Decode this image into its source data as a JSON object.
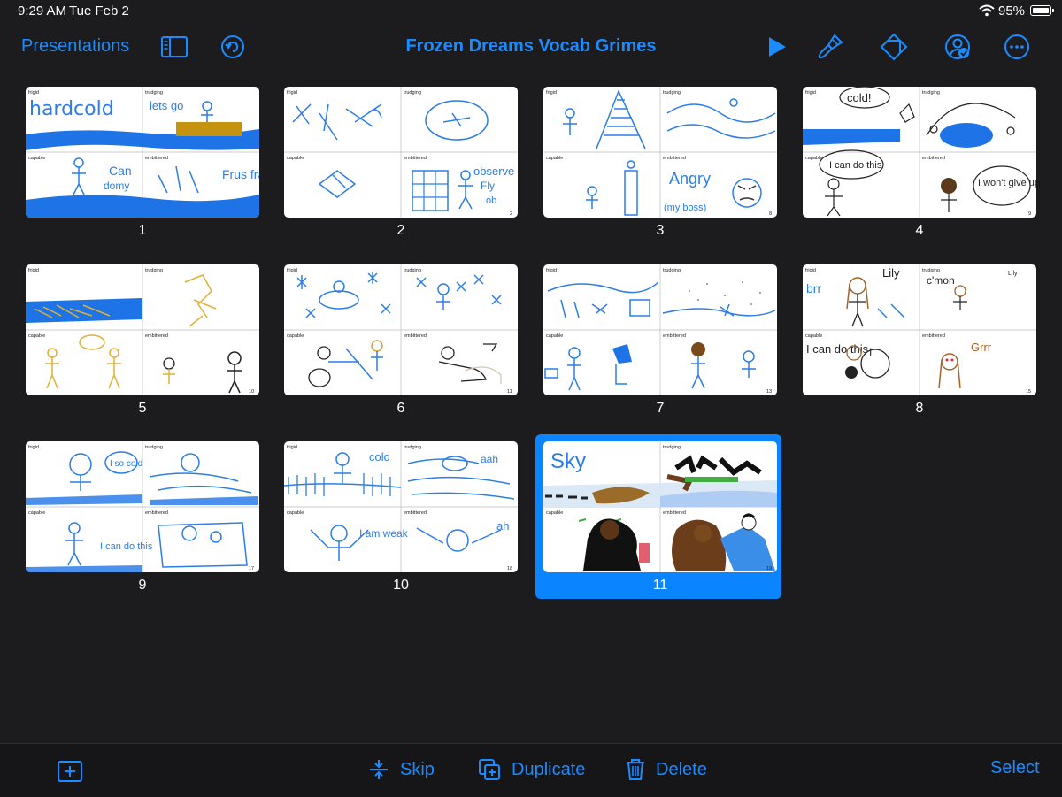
{
  "status": {
    "time": "9:29 AM",
    "date": "Tue Feb 2",
    "battery": "95%"
  },
  "toolbar": {
    "back_label": "Presentations",
    "title": "Frozen Dreams Vocab Grimes",
    "icons": [
      "sidebar-toggle-icon",
      "undo-icon",
      "play-icon",
      "paintbrush-icon",
      "animate-icon",
      "collaborate-icon",
      "more-icon"
    ]
  },
  "quadrant_labels": [
    "frigid",
    "trudging",
    "capable",
    "embittered"
  ],
  "slides": [
    {
      "number": "1",
      "corner": "",
      "selected": false,
      "scribbles": [
        "hardcold",
        "lets go",
        "Can",
        "domy",
        "Frus frat"
      ]
    },
    {
      "number": "2",
      "corner": "2",
      "selected": false,
      "scribbles": [
        "observe",
        "Fly",
        "ob"
      ]
    },
    {
      "number": "3",
      "corner": "8",
      "selected": false,
      "scribbles": [
        "Angry",
        "(my boss)"
      ]
    },
    {
      "number": "4",
      "corner": "9",
      "selected": false,
      "scribbles": [
        "cold!",
        "I can do this",
        "I won't give up"
      ]
    },
    {
      "number": "5",
      "corner": "10",
      "selected": false,
      "scribbles": []
    },
    {
      "number": "6",
      "corner": "11",
      "selected": false,
      "scribbles": []
    },
    {
      "number": "7",
      "corner": "13",
      "selected": false,
      "scribbles": []
    },
    {
      "number": "8",
      "corner": "15",
      "selected": false,
      "scribbles": [
        "Lily",
        "brr",
        "c'mon",
        "Lily",
        "I can do this",
        "Grrr"
      ]
    },
    {
      "number": "9",
      "corner": "17",
      "selected": false,
      "scribbles": [
        "I so cold",
        "I can do this"
      ]
    },
    {
      "number": "10",
      "corner": "18",
      "selected": false,
      "scribbles": [
        "cold",
        "aah",
        "I am weak",
        "ah"
      ]
    },
    {
      "number": "11",
      "corner": "19",
      "selected": true,
      "scribbles": [
        "Sky"
      ]
    }
  ],
  "bottom": {
    "skip_label": "Skip",
    "duplicate_label": "Duplicate",
    "delete_label": "Delete",
    "select_label": "Select"
  },
  "colors": {
    "accent": "#1a8cff",
    "selected": "#0a84ff",
    "background": "#1c1c1e",
    "scribble_blue": "#2b7de9",
    "gold": "#e0b030",
    "brown": "#8b5a2b"
  }
}
